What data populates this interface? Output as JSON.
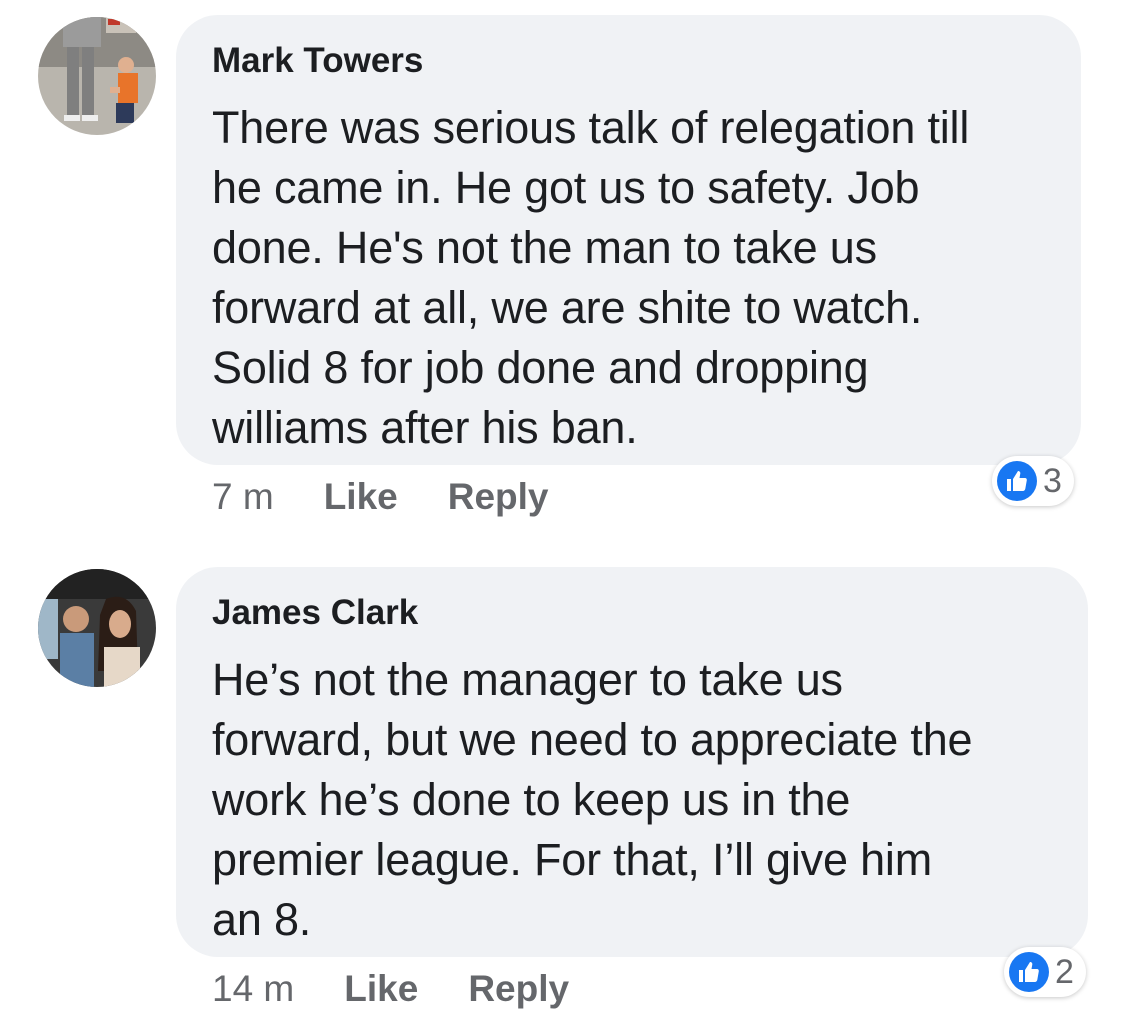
{
  "comments": [
    {
      "author": "Mark Towers",
      "text": "There was serious talk of relegation till he came in. He got us to safety. Job done. He's not the man to take us forward at all, we are shite to watch. Solid 8 for job done and dropping williams after his ban.",
      "lines": [
        "There was serious talk of relegation till",
        "he came in. He got us to safety. Job",
        "done. He's not the man to take us",
        "forward at all, we are shite to watch.",
        "Solid 8 for job done and dropping",
        "williams after his ban."
      ],
      "time": "7 m",
      "like_label": "Like",
      "reply_label": "Reply",
      "reaction_count": "3",
      "reaction_icon": "like-icon"
    },
    {
      "author": "James Clark",
      "lines": [
        "He’s not the manager to take us",
        "forward, but we need to appreciate the",
        "work he’s done to keep us in the",
        "premier league. For that, I’ll give him",
        "an 8."
      ],
      "time": "14 m",
      "like_label": "Like",
      "reply_label": "Reply",
      "reaction_count": "2",
      "reaction_icon": "like-icon"
    }
  ],
  "colors": {
    "bubble": "#f0f2f5",
    "meta_text": "#65676b",
    "like_blue": "#1877f2"
  }
}
